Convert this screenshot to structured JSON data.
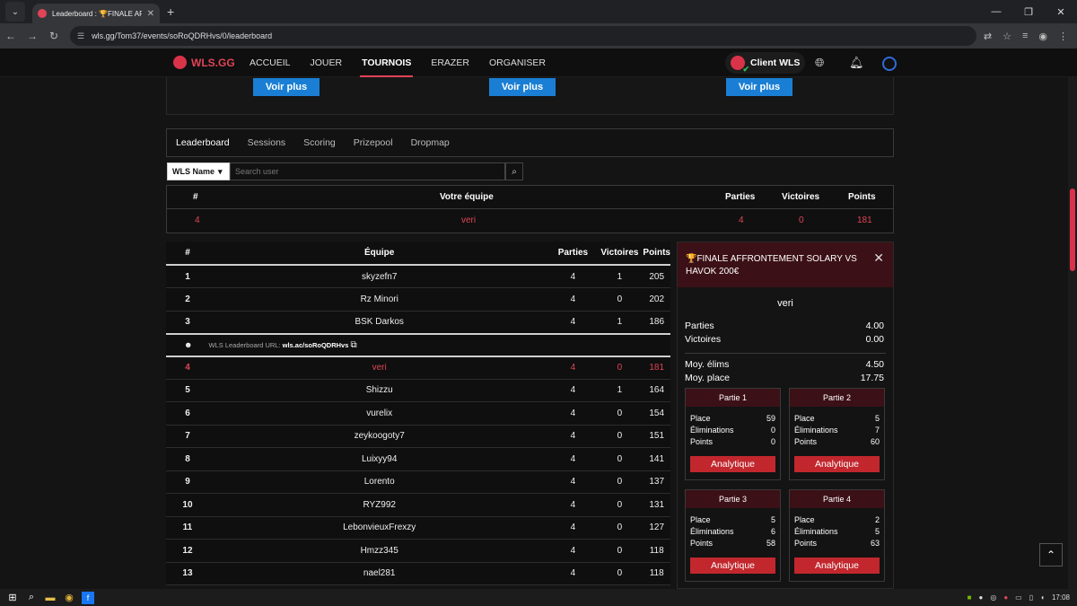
{
  "browser": {
    "tab_title": "Leaderboard : 🏆FINALE AFFRONT",
    "url": "wls.gg/Tom37/events/soRoQDRHvs/0/leaderboard"
  },
  "nav": {
    "logo": "WLS.GG",
    "items": [
      "ACCUEIL",
      "JOUER",
      "TOURNOIS",
      "ERAZER",
      "ORGANISER"
    ],
    "active": "TOURNOIS",
    "client": "Client WLS"
  },
  "voir_plus": "Voir plus",
  "tabs": [
    "Leaderboard",
    "Sessions",
    "Scoring",
    "Prizepool",
    "Dropmap"
  ],
  "search": {
    "select": "WLS Name",
    "placeholder": "Search user"
  },
  "my_team": {
    "headers": {
      "rank": "#",
      "team": "Votre équipe",
      "games": "Parties",
      "wins": "Victoires",
      "points": "Points"
    },
    "rank": "4",
    "team": "veri",
    "games": "4",
    "wins": "0",
    "points": "181"
  },
  "leaderboard": {
    "headers": {
      "rank": "#",
      "team": "Équipe",
      "games": "Parties",
      "wins": "Victoires",
      "points": "Points"
    },
    "url_label": "WLS Leaderboard URL:",
    "url_value": "wls.ac/soRoQDRHvs",
    "rows": [
      {
        "rank": "1",
        "team": "skyzefn7",
        "games": "4",
        "wins": "1",
        "points": "205"
      },
      {
        "rank": "2",
        "team": "Rz Minori",
        "games": "4",
        "wins": "0",
        "points": "202"
      },
      {
        "rank": "3",
        "team": "BSK Darkos",
        "games": "4",
        "wins": "1",
        "points": "186"
      },
      {
        "rank": "4",
        "team": "veri",
        "games": "4",
        "wins": "0",
        "points": "181"
      },
      {
        "rank": "5",
        "team": "Shizzu",
        "games": "4",
        "wins": "1",
        "points": "164"
      },
      {
        "rank": "6",
        "team": "vurelix",
        "games": "4",
        "wins": "0",
        "points": "154"
      },
      {
        "rank": "7",
        "team": "zeykoogoty7",
        "games": "4",
        "wins": "0",
        "points": "151"
      },
      {
        "rank": "8",
        "team": "Luixyy94",
        "games": "4",
        "wins": "0",
        "points": "141"
      },
      {
        "rank": "9",
        "team": "Lorento",
        "games": "4",
        "wins": "0",
        "points": "137"
      },
      {
        "rank": "10",
        "team": "RYZ992",
        "games": "4",
        "wins": "0",
        "points": "131"
      },
      {
        "rank": "11",
        "team": "LebonvieuxFrexzy",
        "games": "4",
        "wins": "0",
        "points": "127"
      },
      {
        "rank": "12",
        "team": "Hmzz345",
        "games": "4",
        "wins": "0",
        "points": "118"
      },
      {
        "rank": "13",
        "team": "nael281",
        "games": "4",
        "wins": "0",
        "points": "118"
      }
    ]
  },
  "panel": {
    "title": "🏆FINALE AFFRONTEMENT SOLARY VS HAVOK 200€",
    "player": "veri",
    "stats": [
      {
        "label": "Parties",
        "value": "4.00"
      },
      {
        "label": "Victoires",
        "value": "0.00"
      }
    ],
    "stats2": [
      {
        "label": "Moy. élims",
        "value": "4.50"
      },
      {
        "label": "Moy. place",
        "value": "17.75"
      }
    ],
    "labels": {
      "place": "Place",
      "elims": "Éliminations",
      "points": "Points",
      "button": "Analytique"
    },
    "parts": [
      {
        "title": "Partie 1",
        "place": "59",
        "elims": "0",
        "points": "0"
      },
      {
        "title": "Partie 2",
        "place": "5",
        "elims": "7",
        "points": "60"
      },
      {
        "title": "Partie 3",
        "place": "5",
        "elims": "6",
        "points": "58"
      },
      {
        "title": "Partie 4",
        "place": "2",
        "elims": "5",
        "points": "63"
      }
    ]
  },
  "taskbar": {
    "time": "17:08"
  }
}
